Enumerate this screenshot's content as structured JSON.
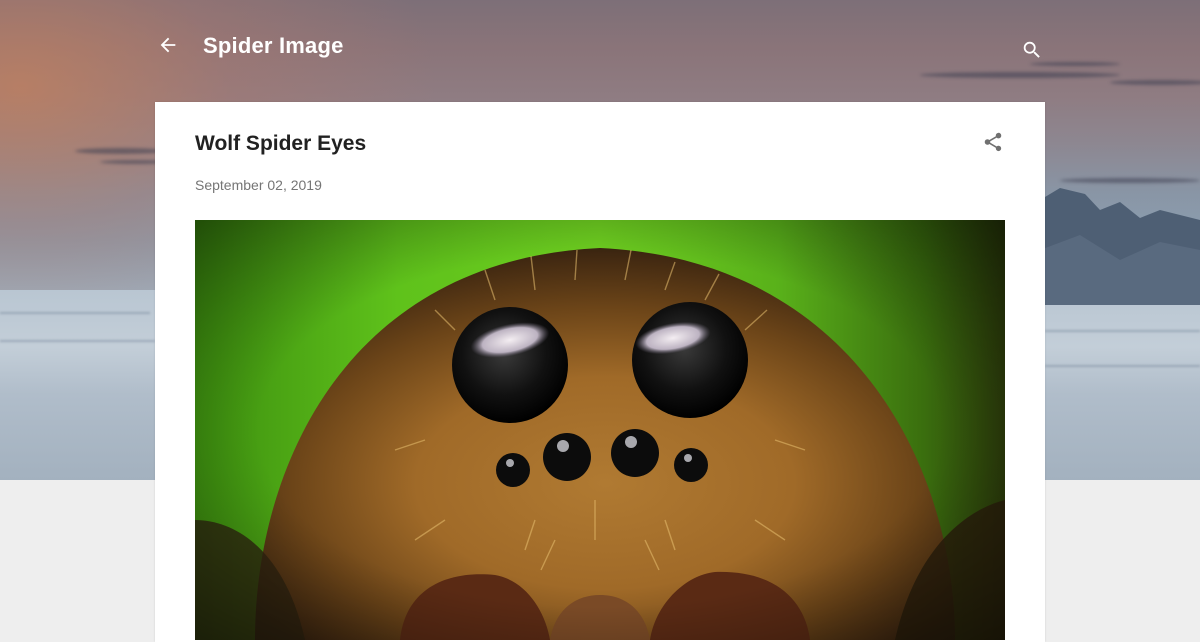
{
  "header": {
    "blog_title": "Spider Image",
    "back_icon": "arrow-left-icon",
    "search_icon": "search-icon"
  },
  "post": {
    "title": "Wolf Spider Eyes",
    "date": "September 02, 2019",
    "share_icon": "share-icon",
    "image_alt": "Wolf Spider Eyes"
  },
  "colors": {
    "card_bg": "#ffffff",
    "page_bg": "#eeeeee",
    "title_text": "#212121",
    "date_text": "#757575",
    "header_text": "#ffffff",
    "icon_gray": "#707070"
  }
}
